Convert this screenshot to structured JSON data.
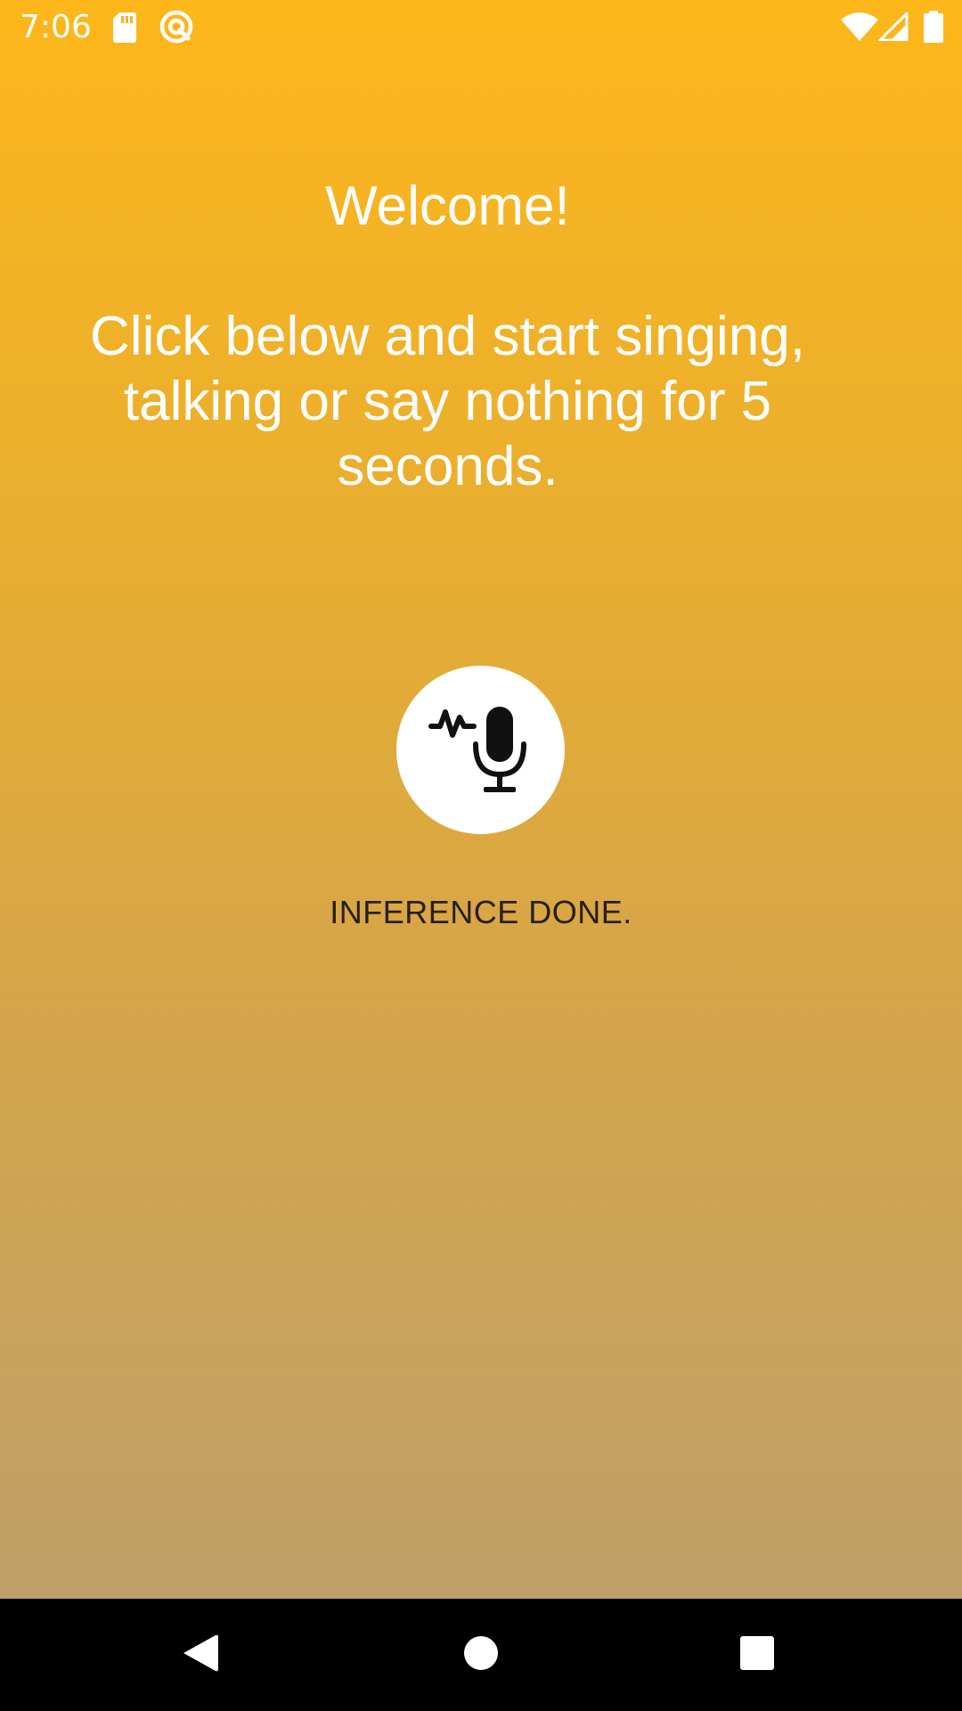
{
  "status_bar": {
    "time": "7:06",
    "icons": [
      "sd-card-icon",
      "sync-circle-icon",
      "wifi-icon",
      "signal-icon",
      "battery-icon"
    ]
  },
  "main": {
    "welcome": "Welcome!",
    "instructions_line1": "Click below and start singing,",
    "instructions_line2": "talking or say nothing for 5",
    "instructions_line3": "seconds.",
    "status": "INFERENCE DONE."
  },
  "nav_bar": {
    "buttons": [
      "back-icon",
      "home-icon",
      "recents-icon"
    ]
  },
  "colors": {
    "gradient_top": "#fdb71a",
    "gradient_bottom": "#ba9e6c",
    "text_primary": "#ffffff",
    "status_text": "#2a1e0a"
  }
}
